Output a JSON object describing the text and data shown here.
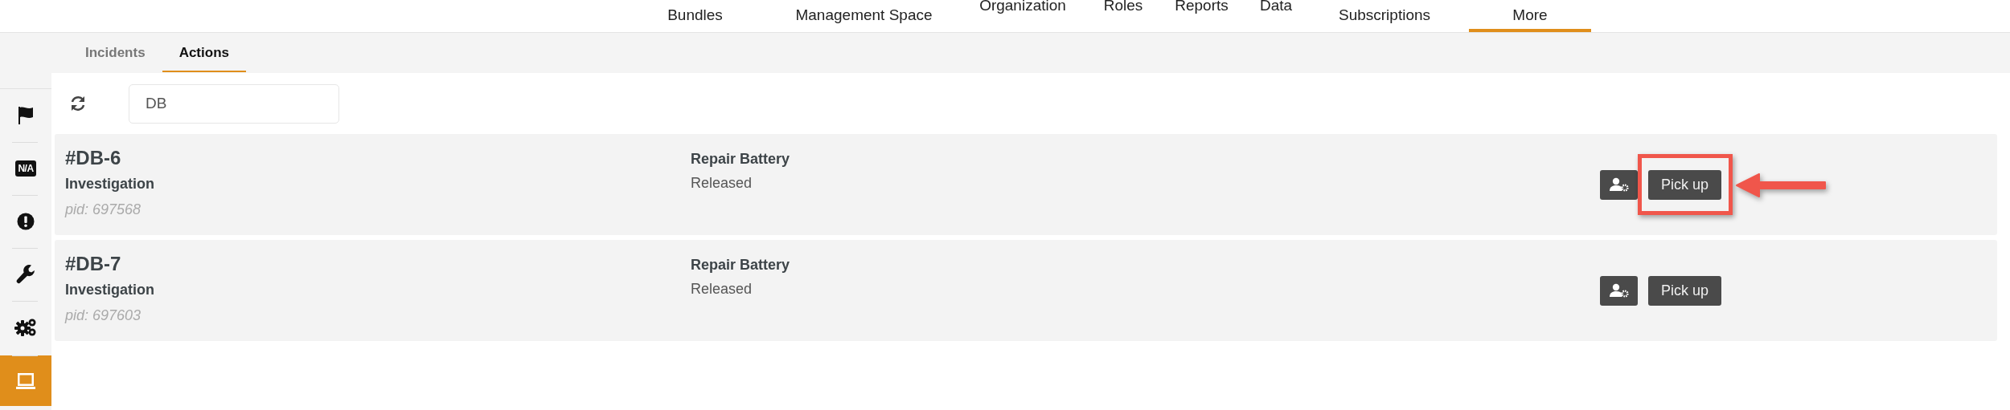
{
  "top_nav": {
    "items": [
      {
        "label": "Bundles",
        "kind": "wrapped",
        "selected": false
      },
      {
        "label": "Management Space",
        "kind": "wrapped",
        "selected": false
      },
      {
        "label": "Organization",
        "kind": "single",
        "selected": false
      },
      {
        "label": "Roles",
        "kind": "single",
        "selected": false
      },
      {
        "label": "Reports",
        "kind": "single",
        "selected": false
      },
      {
        "label": "Data",
        "kind": "single",
        "selected": false
      },
      {
        "label": "Subscriptions",
        "kind": "wrapped",
        "selected": false
      },
      {
        "label": "More",
        "kind": "wrapped",
        "selected": true
      }
    ]
  },
  "tabs": [
    {
      "label": "Incidents",
      "selected": false
    },
    {
      "label": "Actions",
      "selected": true
    }
  ],
  "sidebar": {
    "items": [
      {
        "kind": "flag",
        "selected": false
      },
      {
        "kind": "na",
        "label": "N/A",
        "selected": false
      },
      {
        "kind": "alert",
        "selected": false
      },
      {
        "kind": "wrench",
        "selected": false
      },
      {
        "kind": "gears",
        "selected": false
      },
      {
        "kind": "screen",
        "selected": true
      }
    ]
  },
  "search": {
    "value": "DB"
  },
  "actions": [
    {
      "id": "#DB-6",
      "type": "Investigation",
      "pid": "pid: 697568",
      "name": "Repair Battery",
      "status": "Released",
      "button": "Pick up",
      "highlighted": true
    },
    {
      "id": "#DB-7",
      "type": "Investigation",
      "pid": "pid: 697603",
      "name": "Repair Battery",
      "status": "Released",
      "button": "Pick up",
      "highlighted": false
    }
  ]
}
